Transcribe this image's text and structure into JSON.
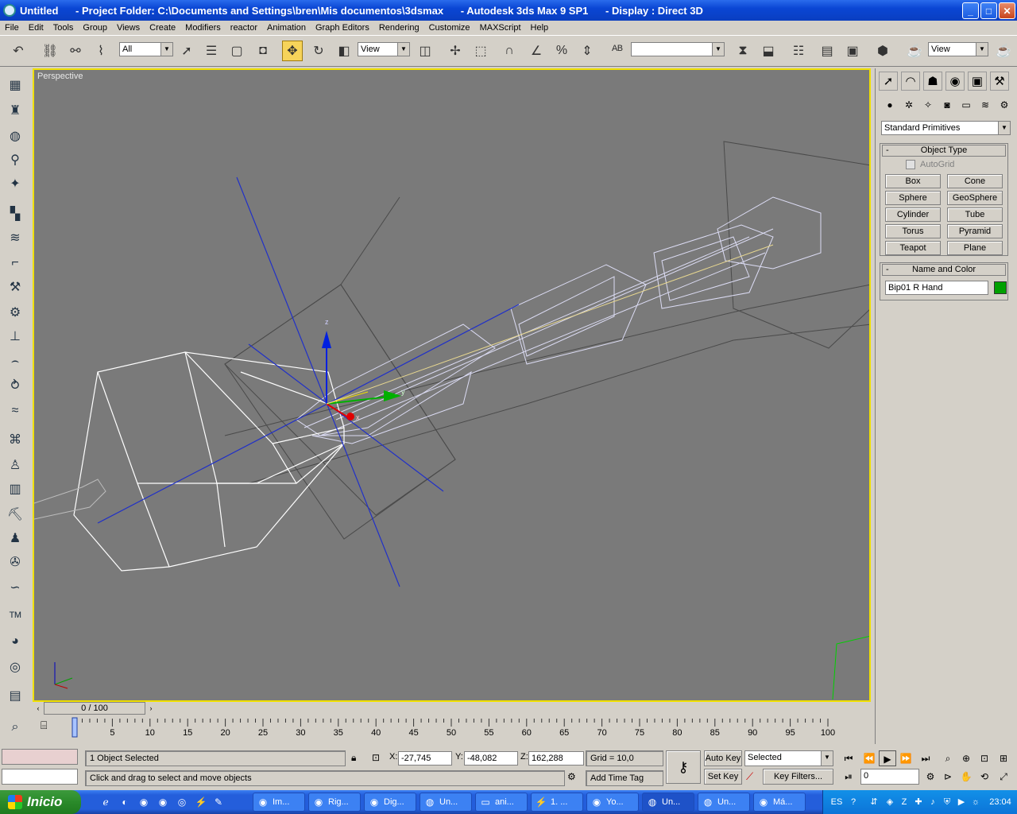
{
  "titlebar": {
    "title": "Untitled      - Project Folder: C:\\Documents and Settings\\bren\\Mis documentos\\3dsmax      - Autodesk 3ds Max 9 SP1      - Display : Direct 3D",
    "minimize": "_",
    "maximize": "□",
    "close": "✕"
  },
  "menu": [
    "File",
    "Edit",
    "Tools",
    "Group",
    "Views",
    "Create",
    "Modifiers",
    "reactor",
    "Animation",
    "Graph Editors",
    "Rendering",
    "Customize",
    "MAXScript",
    "Help"
  ],
  "toolbar": {
    "selection_filter": "All",
    "ref_coord": "View",
    "named_selection": "",
    "view_dropdown": "View"
  },
  "viewport": {
    "label": "Perspective",
    "gizmo_axes": {
      "z": "z",
      "y": "y",
      "x": "x"
    }
  },
  "command_panel": {
    "category": "Standard Primitives",
    "object_type": {
      "title": "Object Type",
      "autogrid": "AutoGrid",
      "buttons": [
        "Box",
        "Cone",
        "Sphere",
        "GeoSphere",
        "Cylinder",
        "Tube",
        "Torus",
        "Pyramid",
        "Teapot",
        "Plane"
      ]
    },
    "name_color": {
      "title": "Name and Color",
      "name": "Bip01 R Hand",
      "color": "#00a000"
    },
    "minus": "-"
  },
  "timeline": {
    "frame": "0 / 100",
    "ticks": [
      "0",
      "5",
      "10",
      "15",
      "20",
      "25",
      "30",
      "35",
      "40",
      "45",
      "50",
      "55",
      "60",
      "65",
      "70",
      "75",
      "80",
      "85",
      "90",
      "95",
      "100"
    ]
  },
  "status": {
    "selection": "1 Object Selected",
    "prompt": "Click and drag to select and move objects",
    "x_label": "X:",
    "x": "-27,745",
    "y_label": "Y:",
    "y": "-48,082",
    "z_label": "Z:",
    "z": "162,288",
    "grid": "Grid = 10,0",
    "add_time_tag": "Add Time Tag",
    "auto_key": "Auto Key",
    "set_key": "Set Key",
    "selected": "Selected",
    "key_filters": "Key Filters...",
    "frame_field": "0"
  },
  "taskbar": {
    "start": "Inicio",
    "tasks": [
      "Im...",
      "Rig...",
      "Dig...",
      "Un...",
      "ani...",
      "1. ...",
      "Yo...",
      "Un...",
      "Un...",
      "Má..."
    ],
    "lang": "ES",
    "clock": "23:04"
  }
}
